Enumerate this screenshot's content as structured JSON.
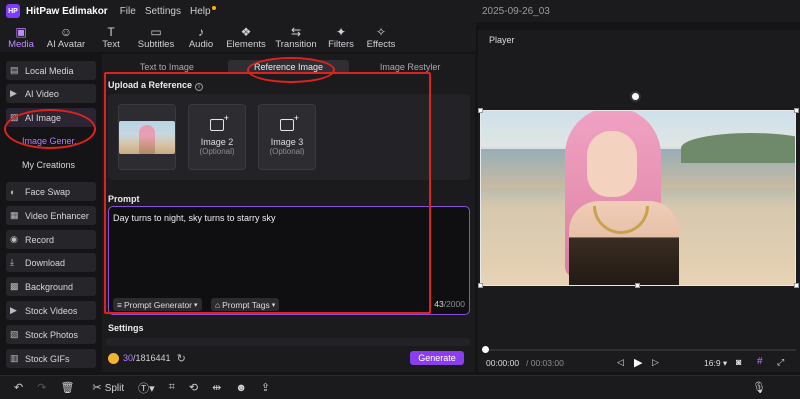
{
  "titlebar": {
    "app_name": "HitPaw Edimakor",
    "menu": [
      "File",
      "Settings",
      "Help"
    ],
    "project_name": "2025-09-26_03"
  },
  "toolbar": {
    "items": [
      {
        "label": "Media",
        "icon": "media-icon",
        "glyph": "▣"
      },
      {
        "label": "AI Avatar",
        "icon": "ai-avatar-icon",
        "glyph": "☺"
      },
      {
        "label": "Text",
        "icon": "text-icon",
        "glyph": "T"
      },
      {
        "label": "Subtitles",
        "icon": "subtitles-icon",
        "glyph": "▭"
      },
      {
        "label": "Audio",
        "icon": "audio-icon",
        "glyph": "♪"
      },
      {
        "label": "Elements",
        "icon": "elements-icon",
        "glyph": "❖"
      },
      {
        "label": "Transition",
        "icon": "transition-icon",
        "glyph": "⇆"
      },
      {
        "label": "Filters",
        "icon": "filters-icon",
        "glyph": "✦"
      },
      {
        "label": "Effects",
        "icon": "effects-icon",
        "glyph": "✧"
      }
    ],
    "active": "Media"
  },
  "sidebar": {
    "items": [
      {
        "label": "Local Media",
        "icon": "folder-icon",
        "glyph": "▤"
      },
      {
        "label": "AI Video",
        "icon": "ai-video-icon",
        "glyph": "▶"
      },
      {
        "label": "AI Image",
        "icon": "ai-image-icon",
        "glyph": "▨"
      },
      {
        "label": "Face Swap",
        "icon": "face-swap-icon",
        "glyph": "◐"
      },
      {
        "label": "Video Enhancer",
        "icon": "video-enhancer-icon",
        "glyph": "▦"
      },
      {
        "label": "Record",
        "icon": "record-icon",
        "glyph": "◉"
      },
      {
        "label": "Download",
        "icon": "download-icon",
        "glyph": "⤓"
      },
      {
        "label": "Background",
        "icon": "background-icon",
        "glyph": "▩"
      },
      {
        "label": "Stock Videos",
        "icon": "stock-videos-icon",
        "glyph": "▶"
      },
      {
        "label": "Stock Photos",
        "icon": "stock-photos-icon",
        "glyph": "▧"
      },
      {
        "label": "Stock GIFs",
        "icon": "stock-gifs-icon",
        "glyph": "▥"
      }
    ],
    "sub_items": [
      "Image Gener...",
      "My Creations"
    ]
  },
  "panel": {
    "tabs": [
      "Text to Image",
      "Reference Image",
      "Image Restyler"
    ],
    "active_tab": "Reference Image",
    "upload_title": "Upload a Reference",
    "slots": [
      {
        "label": "Image 2",
        "sub": "(Optional)"
      },
      {
        "label": "Image 3",
        "sub": "(Optional)"
      }
    ],
    "prompt_title": "Prompt",
    "prompt_text": "Day turns to night, sky turns to starry sky",
    "prompt_generator": "Prompt Generator",
    "prompt_tags": "Prompt Tags",
    "counter_current": "43",
    "counter_max": "/2000",
    "settings_title": "Settings",
    "credits_used": "30",
    "credits_total": "/1816441",
    "generate": "Generate"
  },
  "player": {
    "title": "Player",
    "time_current": "00:00:00",
    "time_total": "/ 00:03:00",
    "aspect": "16:9"
  },
  "bottombar": {
    "split": "Split"
  },
  "colors": {
    "accent": "#8b3df0",
    "accent_text": "#b77bff",
    "annotation": "#e0221f"
  }
}
